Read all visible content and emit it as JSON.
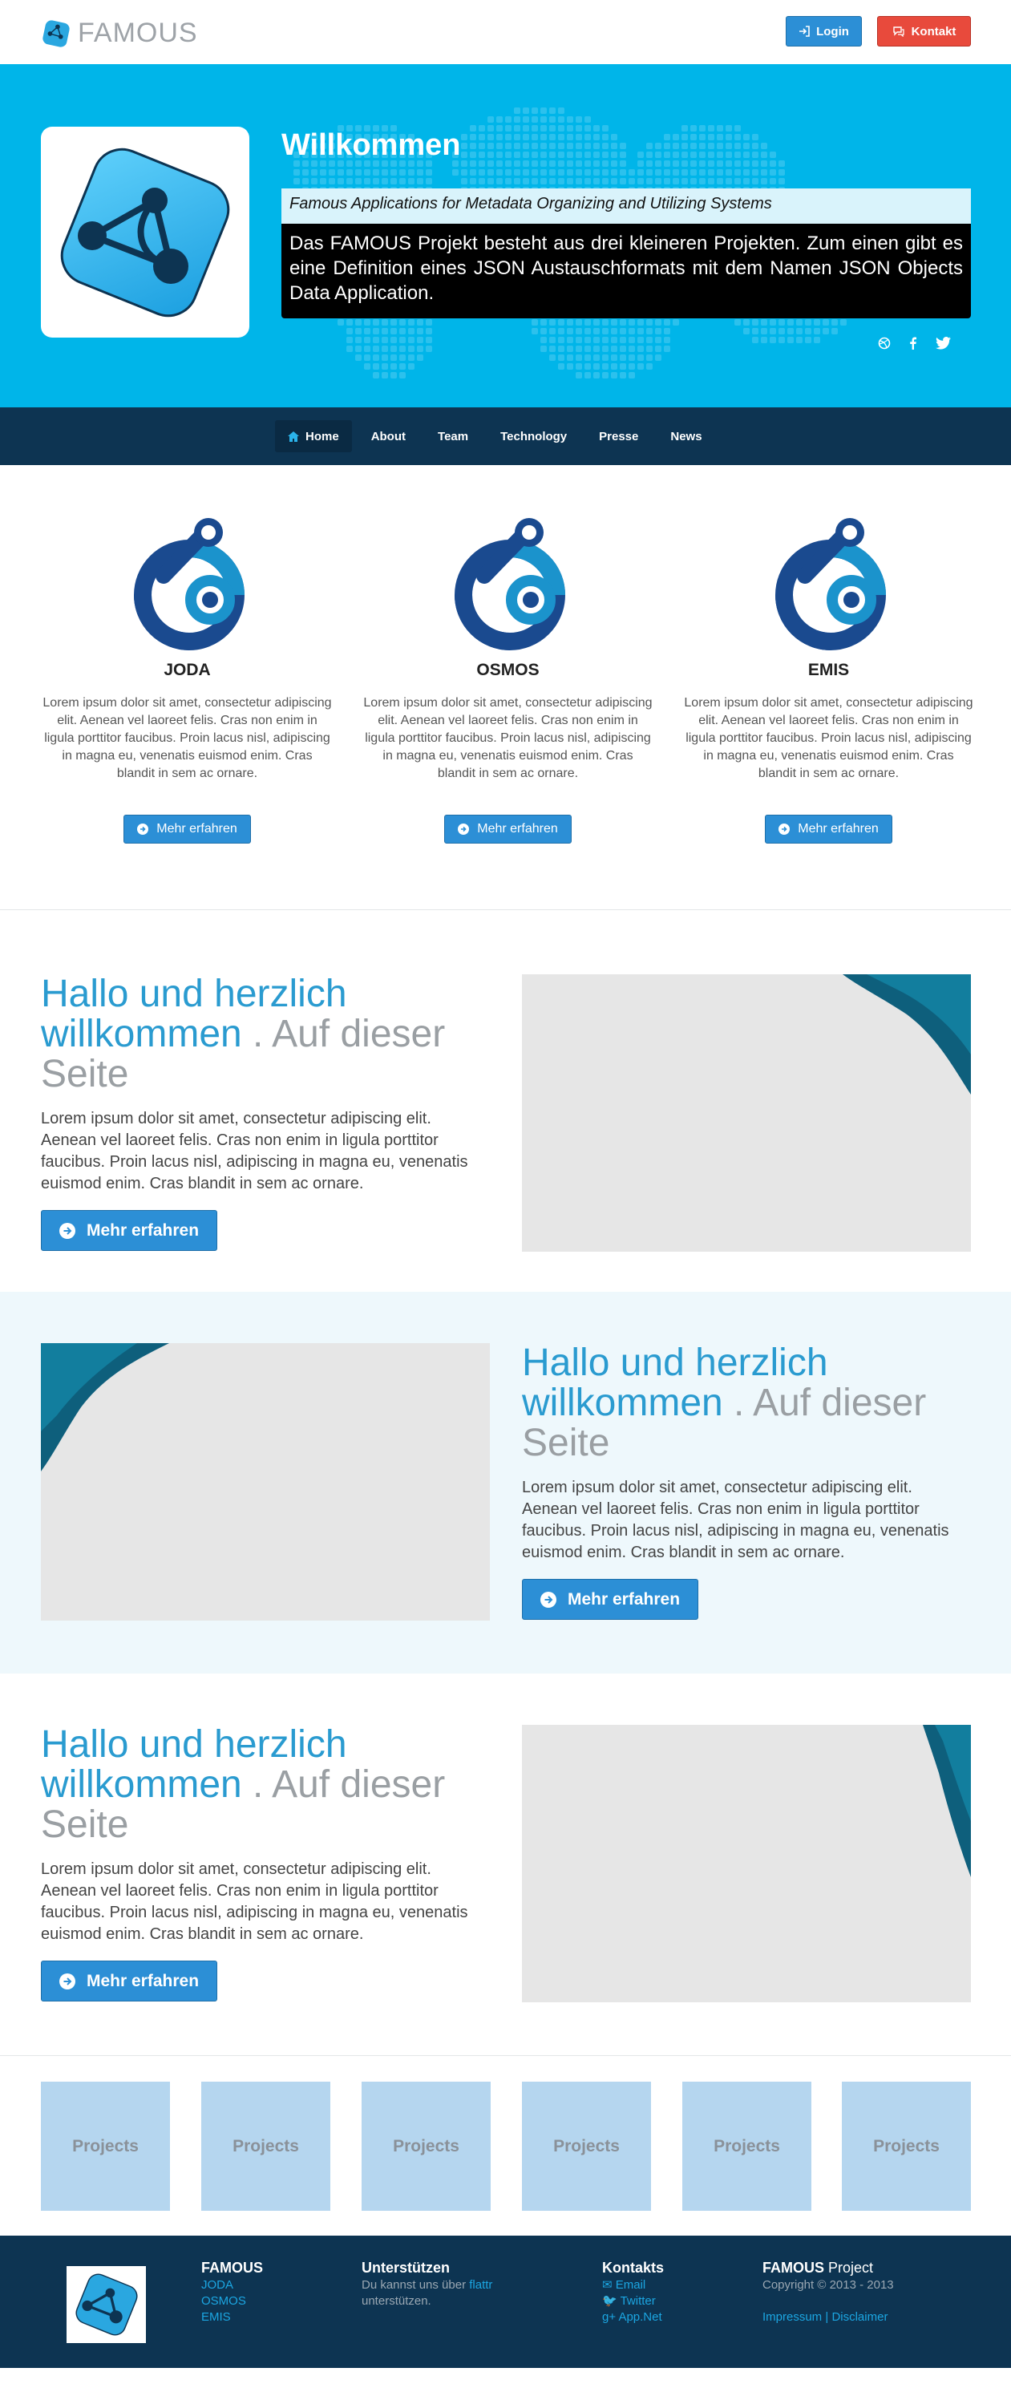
{
  "header": {
    "brand": "FAMOUS",
    "login_label": "Login",
    "contact_label": "Kontakt"
  },
  "hero": {
    "title": "Willkommen",
    "subtitle": "Famous Applications for Metadata Organizing and Utilizing Systems",
    "description": "Das FAMOUS Projekt besteht aus drei kleineren Projekten. Zum einen gibt es eine Definition eines JSON Austauschformats mit dem Namen JSON Objects Data Application.",
    "social": [
      "dribbble-icon",
      "facebook-icon",
      "twitter-icon"
    ]
  },
  "nav": {
    "items": [
      {
        "label": "Home",
        "active": true
      },
      {
        "label": "About",
        "active": false
      },
      {
        "label": "Team",
        "active": false
      },
      {
        "label": "Technology",
        "active": false
      },
      {
        "label": "Presse",
        "active": false
      },
      {
        "label": "News",
        "active": false
      }
    ]
  },
  "features": [
    {
      "title": "JODA",
      "text": "Lorem ipsum dolor sit amet, consectetur adipiscing elit. Aenean vel laoreet felis. Cras non enim in ligula porttitor faucibus. Proin lacus nisl, adipiscing in magna eu, venenatis euismod enim. Cras blandit in sem ac ornare.",
      "button": "Mehr erfahren"
    },
    {
      "title": "OSMOS",
      "text": "Lorem ipsum dolor sit amet, consectetur adipiscing elit. Aenean vel laoreet felis. Cras non enim in ligula porttitor faucibus. Proin lacus nisl, adipiscing in magna eu, venenatis euismod enim. Cras blandit in sem ac ornare.",
      "button": "Mehr erfahren"
    },
    {
      "title": "EMIS",
      "text": "Lorem ipsum dolor sit amet, consectetur adipiscing elit. Aenean vel laoreet felis. Cras non enim in ligula porttitor faucibus. Proin lacus nisl, adipiscing in magna eu, venenatis euismod enim. Cras blandit in sem ac ornare.",
      "button": "Mehr erfahren"
    }
  ],
  "sections": [
    {
      "heading_main": "Hallo und herzlich willkommen",
      "heading_muted": " . Auf dieser Seite",
      "text": "Lorem ipsum dolor sit amet, consectetur adipiscing elit. Aenean vel laoreet felis. Cras non enim in ligula porttitor faucibus. Proin lacus nisl, adipiscing in magna eu, venenatis euismod enim. Cras blandit in sem ac ornare.",
      "button": "Mehr erfahren"
    },
    {
      "heading_main": "Hallo und herzlich willkommen",
      "heading_muted": " . Auf dieser Seite",
      "text": "Lorem ipsum dolor sit amet, consectetur adipiscing elit. Aenean vel laoreet felis. Cras non enim in ligula porttitor faucibus. Proin lacus nisl, adipiscing in magna eu, venenatis euismod enim. Cras blandit in sem ac ornare.",
      "button": "Mehr erfahren"
    },
    {
      "heading_main": "Hallo und herzlich willkommen",
      "heading_muted": " . Auf dieser Seite",
      "text": "Lorem ipsum dolor sit amet, consectetur adipiscing elit. Aenean vel laoreet felis. Cras non enim in ligula porttitor faucibus. Proin lacus nisl, adipiscing in magna eu, venenatis euismod enim. Cras blandit in sem ac ornare.",
      "button": "Mehr erfahren"
    }
  ],
  "projects": [
    "Projects",
    "Projects",
    "Projects",
    "Projects",
    "Projects",
    "Projects"
  ],
  "footer": {
    "col1": {
      "title": "FAMOUS",
      "links": [
        "JODA",
        "OSMOS",
        "EMIS"
      ]
    },
    "col2": {
      "title": "Unterstützen",
      "text_before": "Du kannst uns über ",
      "link": "flattr",
      "text_after": "unterstützen."
    },
    "col3": {
      "title": "Kontakts",
      "links": [
        "Email",
        "Twitter",
        "App.Net"
      ]
    },
    "col4": {
      "title_bold": "FAMOUS",
      "title_rest": " Project",
      "copyright": "Copyright © 2013 - 2013",
      "link1": "Impressum",
      "separator": "|",
      "link2": "Disclaimer"
    }
  },
  "colors": {
    "hero_bg": "#00b5e9",
    "nav_bg": "#0d3452",
    "primary": "#2c8fd6",
    "danger": "#e84a3c",
    "heading_blue": "#2a9bd0"
  }
}
